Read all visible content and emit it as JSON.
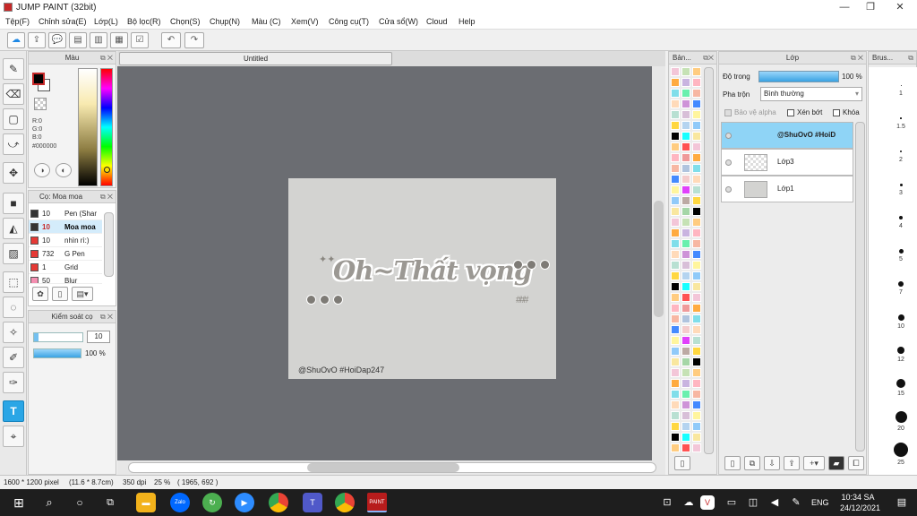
{
  "window": {
    "title": "JUMP PAINT (32bit)",
    "minimize": "—",
    "maximize": "❐",
    "close": "✕"
  },
  "menu": [
    "Tệp(F)",
    "Chỉnh sửa(E)",
    "Lớp(L)",
    "Bộ lọc(R)",
    "Chọn(S)",
    "Chụp(N)",
    "Màu (C)",
    "Xem(V)",
    "Công cụ(T)",
    "Cửa sổ(W)",
    "Cloud",
    "Help"
  ],
  "toolbar": {
    "icons": [
      "cloud-icon",
      "export-icon",
      "comment-icon",
      "message-icon",
      "page-icon",
      "grid-page-icon",
      "checklist-icon",
      "undo-icon",
      "redo-icon"
    ]
  },
  "color_panel": {
    "title": "Màu",
    "r": "R:0",
    "g": "G:0",
    "b": "B:0",
    "hex": "#000000",
    "foreground": "#000000",
    "background": "#ffffff"
  },
  "brush_panel": {
    "title": "Cọ: Moa moa",
    "brushes": [
      {
        "size": "10",
        "name": "Pen (Shar",
        "color": "#333333"
      },
      {
        "size": "10",
        "name": "Moa moa",
        "color": "#333333",
        "selected": true
      },
      {
        "size": "10",
        "name": "nhìn rì:)",
        "color": "#e53935"
      },
      {
        "size": "732",
        "name": "G Pen",
        "color": "#e53935"
      },
      {
        "size": "1",
        "name": "Grid",
        "color": "#e53935"
      },
      {
        "size": "50",
        "name": "Blur",
        "color": "#f48fb1"
      }
    ]
  },
  "control_panel": {
    "title": "Kiểm soát cọ",
    "size_value": "10",
    "opacity_value": "100 %",
    "size_fraction": 0.1,
    "opacity_fraction": 1.0
  },
  "canvas": {
    "tab_title": "Untitled",
    "art_text": "Oh~Thất vọng",
    "credit": "@ShuOvO #HoiDap247"
  },
  "palette_panel": {
    "title": "Bản..."
  },
  "layer_panel": {
    "title": "Lớp",
    "opacity_label": "Độ trong",
    "opacity_value": "100 %",
    "blend_label": "Pha trộn",
    "blend_value": "Bình thường",
    "protect_alpha": "Bảo vệ alpha",
    "clipping": "Xén bớt",
    "lock": "Khóa",
    "layers": [
      {
        "name": "@ShuOvO #HoiD",
        "selected": true
      },
      {
        "name": "Lớp3",
        "selected": false
      },
      {
        "name": "Lớp1",
        "selected": false
      }
    ]
  },
  "brush_size_panel": {
    "title": "Brus...",
    "ticks": [
      "1",
      "1.5",
      "2",
      "3",
      "4",
      "5",
      "7",
      "10",
      "12",
      "15",
      "20",
      "25"
    ]
  },
  "status": {
    "size": "1600 * 1200 pixel",
    "cm": "(11.6 * 8.7cm)",
    "dpi": "350 dpi",
    "zoom": "25 %",
    "coords": "( 1965, 692 )"
  },
  "taskbar": {
    "language": "ENG",
    "time": "10:34 SA",
    "date": "24/12/2021"
  }
}
